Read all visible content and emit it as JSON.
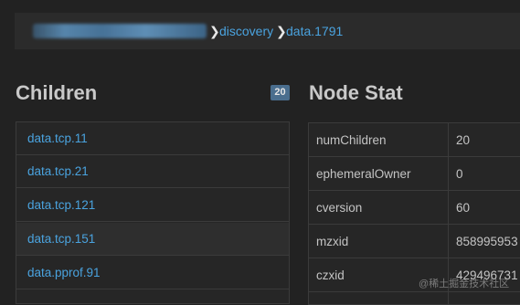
{
  "breadcrumb": {
    "items": [
      {
        "label": "discovery"
      },
      {
        "label": "data.1791"
      }
    ],
    "separator": "❯"
  },
  "children": {
    "title": "Children",
    "count": "20",
    "items": [
      {
        "label": "data.tcp.11"
      },
      {
        "label": "data.tcp.21"
      },
      {
        "label": "data.tcp.121"
      },
      {
        "label": "data.tcp.151"
      },
      {
        "label": "data.pprof.91"
      }
    ]
  },
  "node_stat": {
    "title": "Node Stat",
    "rows": [
      {
        "key": "numChildren",
        "value": "20"
      },
      {
        "key": "ephemeralOwner",
        "value": "0"
      },
      {
        "key": "cversion",
        "value": "60"
      },
      {
        "key": "mzxid",
        "value": "858995953"
      },
      {
        "key": "czxid",
        "value": "429496731"
      }
    ]
  },
  "watermark": "@稀土掘金技术社区",
  "colors": {
    "background": "#222222",
    "link": "#4aa3df",
    "badge": "#4a6e8e",
    "text": "#c4c4c4"
  }
}
